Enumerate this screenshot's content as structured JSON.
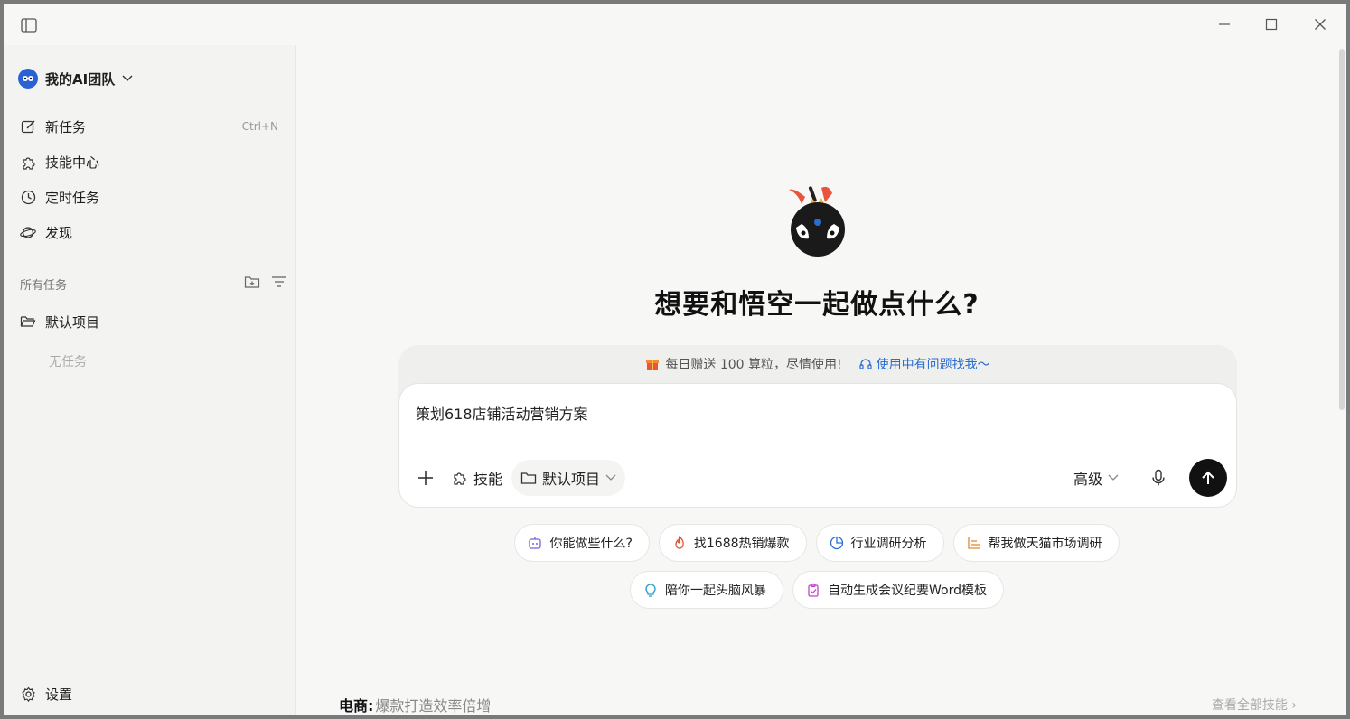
{
  "sidebar": {
    "team_name": "我的AI团队",
    "nav": [
      {
        "label": "新任务",
        "shortcut": "Ctrl+N"
      },
      {
        "label": "技能中心"
      },
      {
        "label": "定时任务"
      },
      {
        "label": "发现"
      }
    ],
    "section_title": "所有任务",
    "project_name": "默认项目",
    "empty_text": "无任务",
    "settings_label": "设置"
  },
  "main": {
    "headline": "想要和悟空一起做点什么?",
    "promo_text": "每日赠送 100 算粒，尽情使用!",
    "promo_link": "使用中有问题找我～",
    "input_value": "策划618店铺活动营销方案",
    "toolbar": {
      "skill_label": "技能",
      "project_label": "默认项目",
      "mode_label": "高级"
    },
    "chips_row1": [
      "你能做些什么?",
      "找1688热销爆款",
      "行业调研分析",
      "帮我做天猫市场调研"
    ],
    "chips_row2": [
      "陪你一起头脑风暴",
      "自动生成会议纪要Word模板"
    ],
    "bottom": {
      "category": "电商:",
      "subtitle": "爆款打造效率倍增",
      "view_all": "查看全部技能 ›"
    }
  },
  "colors": {
    "accent_link": "#2a6dd1",
    "send_button": "#111111",
    "sidebar_bg": "#f3f3f2"
  }
}
